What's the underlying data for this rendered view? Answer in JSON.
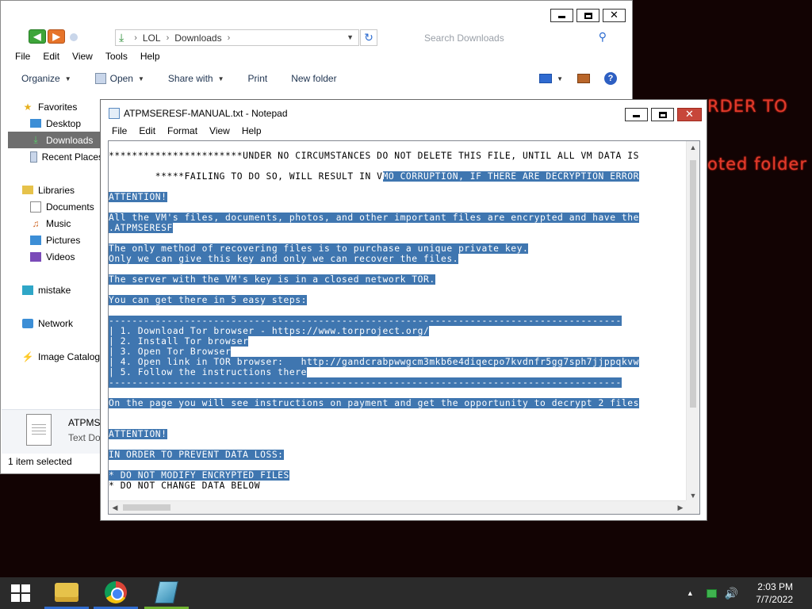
{
  "desktop": {
    "bg_text_1": "RDER TO",
    "bg_text_2": "oted folder"
  },
  "explorer": {
    "window_controls": {
      "minimize": "—",
      "maximize": "☐",
      "close": "✕"
    },
    "address": {
      "crumbs": [
        "LOL",
        "Downloads"
      ]
    },
    "search_placeholder": "Search Downloads",
    "menu": [
      "File",
      "Edit",
      "View",
      "Tools",
      "Help"
    ],
    "toolbar": {
      "organize": "Organize",
      "open": "Open",
      "share_with": "Share with",
      "print": "Print",
      "new_folder": "New folder"
    },
    "nav": {
      "favorites": "Favorites",
      "desktop": "Desktop",
      "downloads": "Downloads",
      "recent_places": "Recent Places",
      "libraries": "Libraries",
      "documents": "Documents",
      "music": "Music",
      "pictures": "Pictures",
      "videos": "Videos",
      "mistake": "mistake",
      "network": "Network",
      "image_catalog": "Image Catalog"
    },
    "details": {
      "name": "ATPMS",
      "type": "Text Do"
    },
    "status": "1 item selected"
  },
  "notepad": {
    "title": "ATPMSERESF-MANUAL.txt - Notepad",
    "menu": [
      "File",
      "Edit",
      "Format",
      "View",
      "Help"
    ],
    "lines": [
      {
        "plain": "***********************UNDER NO CIRCUMSTANCES DO NOT DELETE THIS FILE, UNTIL ALL VM DATA IS",
        "hl": ""
      },
      {
        "plain": "",
        "hl": ""
      },
      {
        "plain": "        *****FAILING TO DO SO, WILL RESULT IN V",
        "hl": "MO CORRUPTION, IF THERE ARE DECRYPTION ERROR"
      },
      {
        "plain": "",
        "hl": ""
      },
      {
        "plain": "",
        "hl": "ATTENTION!"
      },
      {
        "plain": "",
        "hl": ""
      },
      {
        "plain": "",
        "hl": "All the VM's files, documents, photos, and other important files are encrypted and have the"
      },
      {
        "plain": "",
        "hl": ".ATPMSERESF"
      },
      {
        "plain": "",
        "hl": ""
      },
      {
        "plain": "",
        "hl": "The only method of recovering files is to purchase a unique private key."
      },
      {
        "plain": "",
        "hl": "Only we can give this key and only we can recover the files."
      },
      {
        "plain": "",
        "hl": ""
      },
      {
        "plain": "",
        "hl": "The server with the VM's key is in a closed network TOR."
      },
      {
        "plain": "",
        "hl": ""
      },
      {
        "plain": "",
        "hl": "You can get there in 5 easy steps:"
      },
      {
        "plain": "",
        "hl": ""
      },
      {
        "plain": "",
        "hl": "----------------------------------------------------------------------------------------"
      },
      {
        "plain": "",
        "hl": "| 1. Download Tor browser - https://www.torproject.org/"
      },
      {
        "plain": "",
        "hl": "| 2. Install Tor browser"
      },
      {
        "plain": "",
        "hl": "| 3. Open Tor Browser"
      },
      {
        "plain": "",
        "hl": "| 4. Open link in TOR browser:   http://gandcrabpwwgcm3mkb6e4diqecpo7kvdnfr5gg7sph7jjppqkvw"
      },
      {
        "plain": "",
        "hl": "| 5. Follow the instructions there"
      },
      {
        "plain": "",
        "hl": "----------------------------------------------------------------------------------------"
      },
      {
        "plain": "",
        "hl": ""
      },
      {
        "plain": "",
        "hl": "On the page you will see instructions on payment and get the opportunity to decrypt 2 files"
      },
      {
        "plain": "",
        "hl": ""
      },
      {
        "plain": "",
        "hl": ""
      },
      {
        "plain": "",
        "hl": "ATTENTION!"
      },
      {
        "plain": "",
        "hl": ""
      },
      {
        "plain": "",
        "hl": "IN ORDER TO PREVENT DATA LOSS:"
      },
      {
        "plain": "",
        "hl": ""
      },
      {
        "plain": "",
        "hl": "* DO NOT MODIFY ENCRYPTED FILES"
      },
      {
        "plain": "* DO NOT CHANGE DATA BELOW",
        "hl": ""
      }
    ]
  },
  "taskbar": {
    "apps": [
      "file-explorer-icon",
      "chrome-icon",
      "notepad-icon"
    ],
    "time": "2:03 PM",
    "date": "7/7/2022"
  }
}
